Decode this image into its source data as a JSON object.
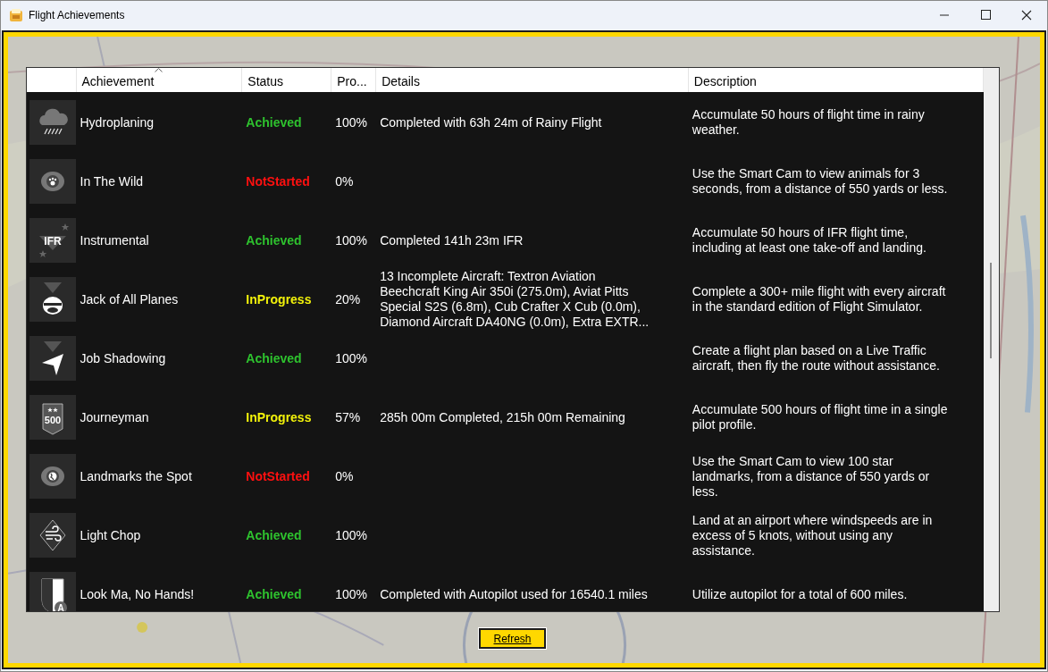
{
  "window": {
    "title": "Flight Achievements"
  },
  "table": {
    "columns": [
      {
        "label": "Achievement",
        "sorted": true
      },
      {
        "label": "Status",
        "sorted": false
      },
      {
        "label": "Pro...",
        "sorted": false
      },
      {
        "label": "Details",
        "sorted": false
      },
      {
        "label": "Description",
        "sorted": false
      }
    ],
    "rows": [
      {
        "kind": "rain",
        "name": "Hydroplaning",
        "status": "Achieved",
        "color": "#2ec22e",
        "progress": "100%",
        "details": "Completed with 63h 24m of Rainy Flight",
        "description": "Accumulate 50 hours of flight time in rainy weather."
      },
      {
        "kind": "paw",
        "name": "In The Wild",
        "status": "NotStarted",
        "color": "#ff1010",
        "progress": "0%",
        "description": "Use the Smart Cam to view animals for 3 seconds, from a distance of 550 yards or less."
      },
      {
        "kind": "chevron",
        "icon_label": "IFR",
        "name": "Instrumental",
        "status": "Achieved",
        "color": "#2ec22e",
        "progress": "100%",
        "details": "Completed 141h 23m IFR",
        "description": "Accumulate 50 hours of IFR flight time, including at least one take-off and landing."
      },
      {
        "kind": "pilot",
        "name": "Jack of All Planes",
        "status": "InProgress",
        "color": "#f2f20a",
        "progress": "20%",
        "details": "13 Incomplete Aircraft: Textron Aviation Beechcraft King Air 350i (275.0m), Aviat Pitts Special S2S (6.8m), Cub Crafter X Cub (0.0m), Diamond Aircraft DA40NG (0.0m), Extra EXTR...",
        "description": "Complete a 300+ mile flight with every aircraft in the standard edition of Flight Simulator."
      },
      {
        "kind": "plane",
        "name": "Job Shadowing",
        "status": "Achieved",
        "color": "#2ec22e",
        "progress": "100%",
        "description": "Create a flight plan based on a Live Traffic aircraft, then fly the route without assistance."
      },
      {
        "kind": "banner",
        "icon_label": "500",
        "name": "Journeyman",
        "status": "InProgress",
        "color": "#f2f20a",
        "progress": "57%",
        "details": "285h 00m Completed, 215h 00m  Remaining",
        "description": "Accumulate 500 hours of flight time in a single pilot profile."
      },
      {
        "kind": "globe",
        "name": "Landmarks the Spot",
        "status": "NotStarted",
        "color": "#ff1010",
        "progress": "0%",
        "description": "Use the Smart Cam to view 100 star landmarks, from a distance of 550 yards or less."
      },
      {
        "kind": "wind",
        "name": "Light Chop",
        "status": "Achieved",
        "color": "#2ec22e",
        "progress": "100%",
        "description": "Land at an airport where windspeeds are in excess of 5 knots, without using any assistance."
      },
      {
        "kind": "shield",
        "icon_label": "A",
        "name": "Look Ma, No Hands!",
        "status": "Achieved",
        "color": "#2ec22e",
        "progress": "100%",
        "details": "Completed with Autopilot used for 16540.1 miles",
        "description": "Utilize autopilot for a total of 600 miles."
      }
    ]
  },
  "refresh_button": "Refresh"
}
